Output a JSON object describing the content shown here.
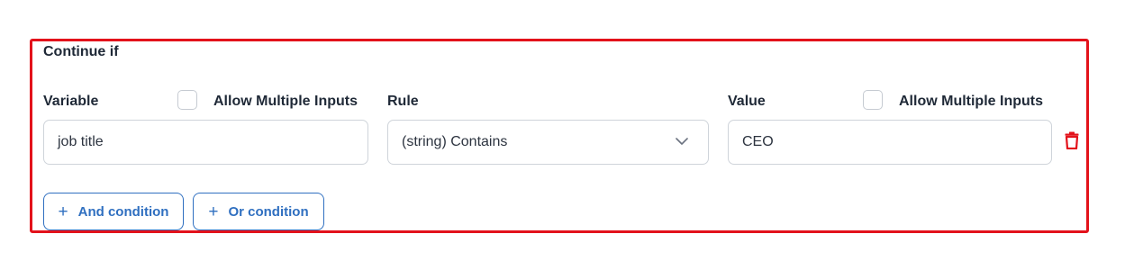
{
  "section": {
    "title": "Continue if"
  },
  "variable": {
    "label": "Variable",
    "allow_multiple_label": "Allow Multiple Inputs",
    "allow_multiple_checked": false,
    "value": "job title"
  },
  "rule": {
    "label": "Rule",
    "selected": "(string) Contains"
  },
  "value": {
    "label": "Value",
    "allow_multiple_label": "Allow Multiple Inputs",
    "allow_multiple_checked": false,
    "value": "CEO"
  },
  "buttons": {
    "and_condition": "And condition",
    "or_condition": "Or condition",
    "plus_symbol": "+"
  },
  "colors": {
    "highlight_border": "#e3121b",
    "accent": "#2f6fc0",
    "delete_icon": "#e3121b"
  },
  "icons": {
    "dropdown": "chevron-down-icon",
    "delete": "trash-icon",
    "add": "plus-icon"
  }
}
